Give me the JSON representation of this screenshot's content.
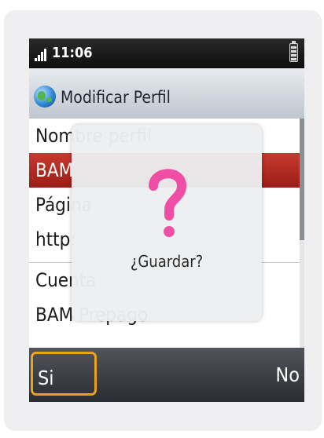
{
  "status_bar": {
    "time": "11:06",
    "signal_icon": "signal-bars-icon",
    "battery_icon": "battery-icon"
  },
  "title_bar": {
    "icon": "globe-icon",
    "title": "Modificar Perfil"
  },
  "list": {
    "rows": [
      {
        "text": "Nombre perfil",
        "selected": false
      },
      {
        "text": "BAM",
        "selected": true
      },
      {
        "text": "Página",
        "selected": false
      },
      {
        "text": "http:",
        "selected": false
      },
      {
        "text": "Cuenta",
        "selected": false
      },
      {
        "text": "BAM Prepago",
        "selected": false
      }
    ]
  },
  "dialog": {
    "icon": "question-mark-icon",
    "message": "¿Guardar?"
  },
  "softkeys": {
    "left": "Si",
    "right": "No"
  },
  "colors": {
    "selected_row": "#b42a22",
    "question_mark": "#ee4fa4",
    "softkey_focus": "#f0a11a"
  }
}
